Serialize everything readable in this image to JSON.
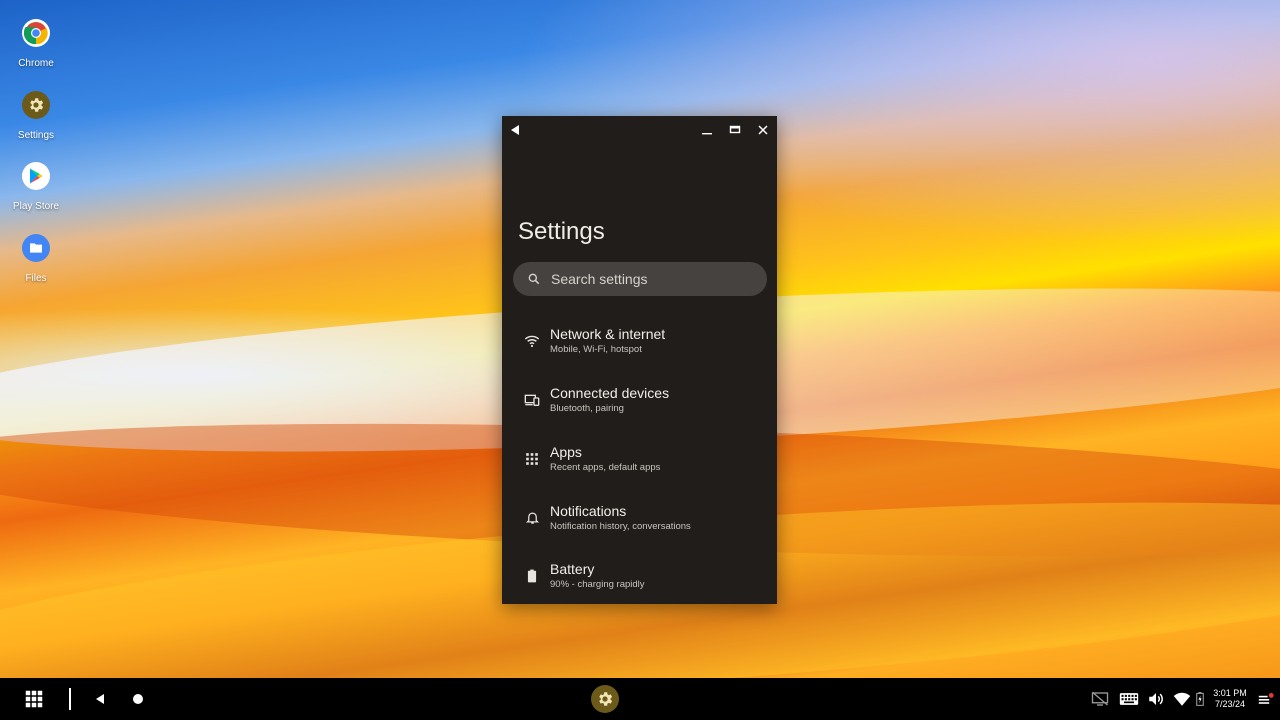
{
  "desktop": {
    "icons": [
      {
        "label": "Chrome",
        "icon": "chrome-icon"
      },
      {
        "label": "Settings",
        "icon": "settings-gear-icon"
      },
      {
        "label": "Play Store",
        "icon": "play-store-icon"
      },
      {
        "label": "Files",
        "icon": "folder-icon"
      }
    ]
  },
  "window": {
    "title": "Settings",
    "search": {
      "placeholder": "Search settings",
      "value": ""
    },
    "items": [
      {
        "title": "Network & internet",
        "subtitle": "Mobile, Wi-Fi, hotspot",
        "icon": "wifi-icon"
      },
      {
        "title": "Connected devices",
        "subtitle": "Bluetooth, pairing",
        "icon": "devices-icon"
      },
      {
        "title": "Apps",
        "subtitle": "Recent apps, default apps",
        "icon": "apps-grid-icon"
      },
      {
        "title": "Notifications",
        "subtitle": "Notification history, conversations",
        "icon": "bell-icon"
      },
      {
        "title": "Battery",
        "subtitle": "90% - charging rapidly",
        "icon": "battery-icon"
      }
    ],
    "colors": {
      "background": "#201d1b",
      "search_bg": "#45423f"
    }
  },
  "taskbar": {
    "time": "3:01 PM",
    "date": "7/23/24",
    "pinned_app": "settings-gear-icon"
  }
}
